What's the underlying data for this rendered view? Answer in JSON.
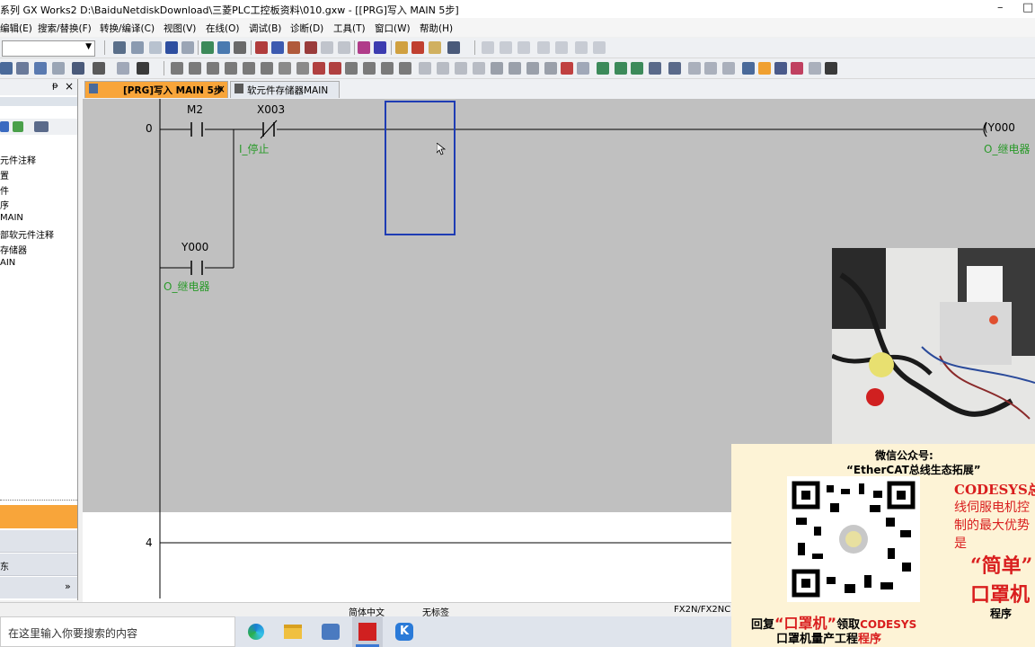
{
  "window": {
    "title": "系列 GX Works2 D:\\BaiduNetdiskDownload\\三菱PLC工控板资料\\010.gxw - [[PRG]写入 MAIN 5步]",
    "minimize": "–",
    "maximize": "□"
  },
  "menu": [
    "编辑(E)",
    "搜索/替换(F)",
    "转换/编译(C)",
    "视图(V)",
    "在线(O)",
    "调试(B)",
    "诊断(D)",
    "工具(T)",
    "窗口(W)",
    "帮助(H)"
  ],
  "navigation": {
    "pin": "ᵽ",
    "close": "×",
    "tree": [
      "元件注释",
      "置",
      "件",
      "序",
      "MAIN",
      "部软元件注释",
      "存储器",
      "AIN"
    ],
    "bottom_item": "东",
    "expand": "»"
  },
  "tabs": [
    {
      "label": "[PRG]写入 MAIN 5步",
      "close": "×"
    },
    {
      "label": "软元件存储器MAIN"
    }
  ],
  "ladder": {
    "rung0": {
      "step": "0",
      "contact1": {
        "device": "M2"
      },
      "contact2": {
        "device": "X003",
        "comment": "I_停止"
      },
      "coil": {
        "device": "(Y000",
        "comment": "O_继电器"
      },
      "branch": {
        "device": "Y000",
        "comment": "O_继电器"
      }
    },
    "rung1": {
      "step": "4"
    }
  },
  "status": {
    "language": "简体中文",
    "label": "无标签",
    "plc": "FX2N/FX2NC"
  },
  "taskbar": {
    "search_placeholder": "在这里输入你要搜索的内容"
  },
  "promo": {
    "line1": "微信公众号:",
    "line2": "“EtherCAT总线生态拓展”",
    "side1": "CODESYS总",
    "side2": "线伺服电机控",
    "side3": "制的最大优势",
    "side4": "是",
    "side5": "“简单”",
    "side6": "口罩机",
    "side7": "程序",
    "reply_pre": "回复",
    "reply_key": "“口罩机”",
    "reply_mid": "领取",
    "reply_brand": "CODESYS",
    "bottom_pre": "口罩机量产工程",
    "bottom_red": "程序"
  },
  "colors": {
    "accent": "#1e3cb4",
    "comment_green": "#2a9a2a",
    "promo_red": "#d91e1e",
    "left_highlight": "#f8a53a"
  }
}
